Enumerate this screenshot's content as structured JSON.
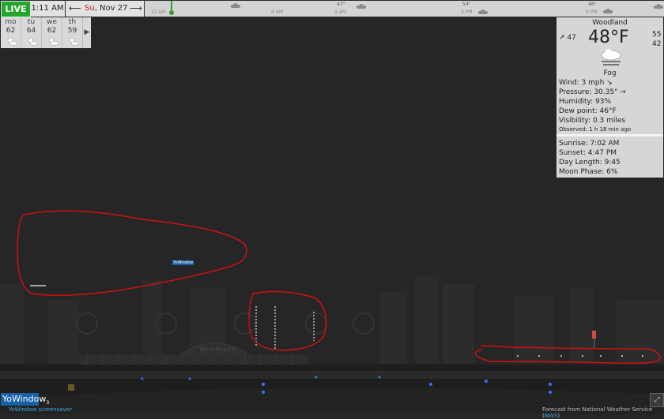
{
  "topbar": {
    "live_label": "LIVE",
    "time": "1:11 AM",
    "date_dow": "Su",
    "date_rest": ", Nov 27",
    "prev_arrow": "⟵",
    "next_arrow": "⟶",
    "timeline": {
      "hour_labels": [
        "12 AM",
        "6 AM",
        "9 AM",
        "3 PM",
        "9 PM"
      ],
      "temps": [
        "47°",
        "54°",
        "46°"
      ]
    }
  },
  "forecast": {
    "days": [
      {
        "day": "mo",
        "temp": "62",
        "icon": "sun-cloud-icon"
      },
      {
        "day": "tu",
        "temp": "64",
        "icon": "sun-cloud-icon"
      },
      {
        "day": "we",
        "temp": "62",
        "icon": "sun-cloud-icon"
      },
      {
        "day": "th",
        "temp": "59",
        "icon": "sun-cloud-icon"
      }
    ],
    "more_arrow": "▶"
  },
  "weather": {
    "location": "Woodland",
    "temperature": "48°F",
    "low": "↗ 47",
    "high": "55",
    "high2": "42",
    "condition": "Fog",
    "condition_icon": "fog-icon",
    "wind": "Wind:  3 mph  ↘",
    "pressure": "Pressure:  30.35\" →",
    "humidity": "Humidity:  93%",
    "dew_point": "Dew point:  46°F",
    "visibility": "Visibility:  0.3 miles",
    "observed": "Observed:  1 h 18 min ago",
    "sunrise": "Sunrise:  7:02 AM",
    "sunset": "Sunset:  4:47 PM",
    "day_length": "Day Length:  9:45",
    "moon_phase": "Moon Phase:  6%"
  },
  "scene": {
    "building_label": "Woodland",
    "watermark": "YoWindow",
    "colors": {
      "annotation": "#d01010",
      "sky": "#262626",
      "runway_light": "#3d6cff"
    }
  },
  "footer": {
    "brand": "YoWindow",
    "brand_version": "3",
    "saver_label": "YoWindow screensaver",
    "forecast_source": "Forecast from National Weather Service (",
    "forecast_source_link": "NWS",
    "forecast_source_end": ")"
  }
}
